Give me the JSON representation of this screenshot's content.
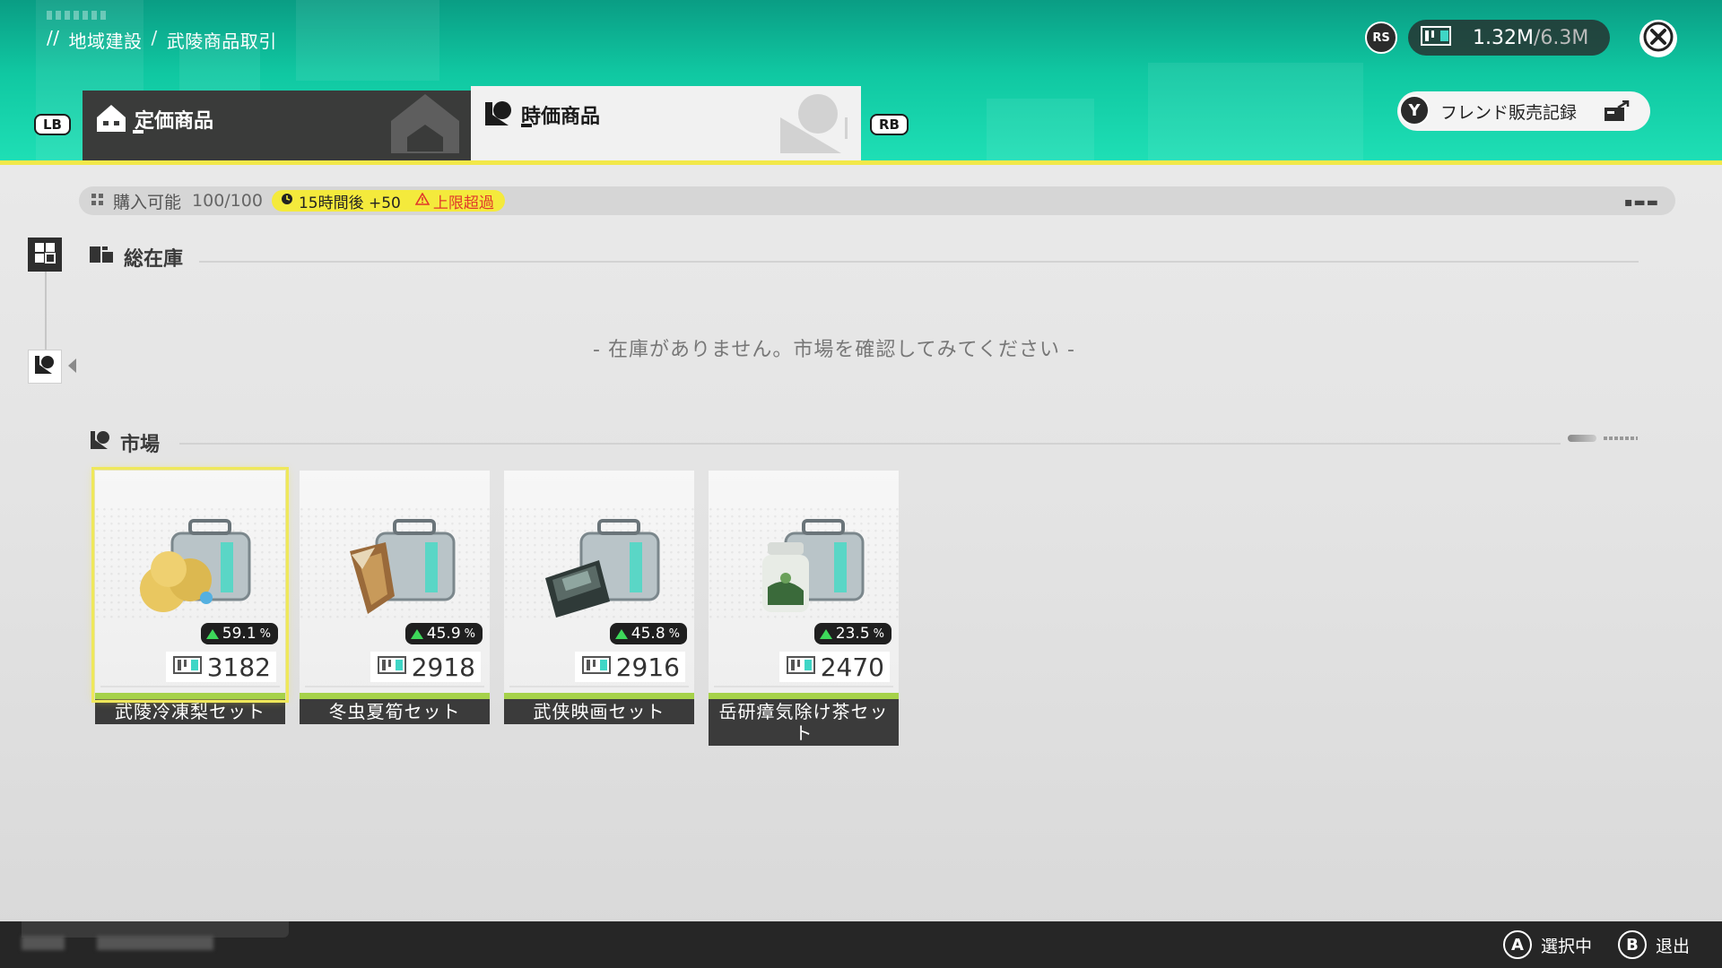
{
  "header": {
    "breadcrumb": {
      "prefix": "//",
      "region": "地域建設",
      "separator": "/",
      "page": "武陵商品取引"
    },
    "lb_label": "LB",
    "rb_label": "RB",
    "tabs": [
      {
        "label": "定価商品",
        "icon": "house-icon",
        "active": false
      },
      {
        "label": "時価商品",
        "icon": "flag-icon",
        "active": true
      }
    ],
    "rs_label": "RS",
    "currency": {
      "icon": "credit-icon",
      "current": "1.32M",
      "separator": "/",
      "max": "6.3M"
    },
    "friend_button": {
      "y_label": "Y",
      "label": "フレンド販売記録"
    }
  },
  "purchase_bar": {
    "label": "購入可能",
    "count": "100/100",
    "timer": "15時間後 +50",
    "warning": "上限超過"
  },
  "inventory": {
    "title": "総在庫",
    "empty_message": "- 在庫がありません。市場を確認してみてください -"
  },
  "market": {
    "title": "市場",
    "items": [
      {
        "name": "武陵冷凍梨セット",
        "change": "59.1",
        "pct": "%",
        "price": "3182",
        "art": "pear"
      },
      {
        "name": "冬虫夏筍セット",
        "change": "45.9",
        "pct": "%",
        "price": "2918",
        "art": "bamboo"
      },
      {
        "name": "武侠映画セット",
        "change": "45.8",
        "pct": "%",
        "price": "2916",
        "art": "film"
      },
      {
        "name": "岳研瘴気除け茶セット",
        "change": "23.5",
        "pct": "%",
        "price": "2470",
        "art": "tea"
      }
    ]
  },
  "footer": {
    "hints": [
      {
        "button": "A",
        "label": "選択中"
      },
      {
        "button": "B",
        "label": "退出"
      }
    ]
  },
  "colors": {
    "header_teal": "#10c8a2",
    "accent_yellow": "#f4ea3c",
    "warning_red": "#e0392b",
    "up_green": "#3dd85a"
  }
}
